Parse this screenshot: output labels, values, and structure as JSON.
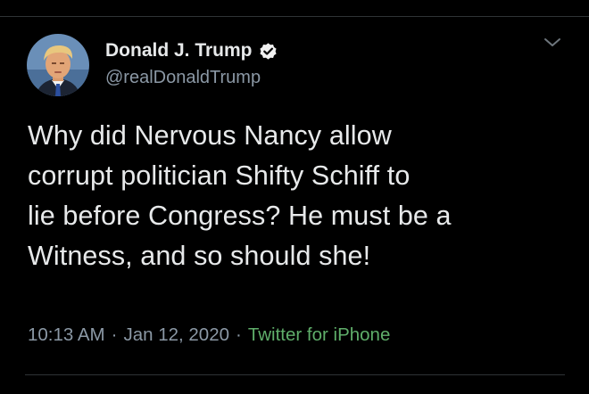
{
  "tweet": {
    "author": {
      "display_name": "Donald J. Trump",
      "handle": "@realDonaldTrump",
      "verified": true
    },
    "text_lines": [
      "Why did Nervous Nancy allow",
      "corrupt politician Shifty Schiff to",
      "lie before Congress? He must be a",
      "Witness, and so should she!"
    ],
    "time": "10:13 AM",
    "separator": "·",
    "date": "Jan 12, 2020",
    "source": "Twitter for iPhone"
  },
  "icons": {
    "verified": "verified-badge-icon",
    "more": "chevron-down-icon",
    "avatar": "profile-photo"
  },
  "colors": {
    "background": "#000000",
    "text_primary": "#e7e9ea",
    "text_secondary": "#8b98a5",
    "source_link": "#5fae6a",
    "divider": "#2f3336"
  }
}
